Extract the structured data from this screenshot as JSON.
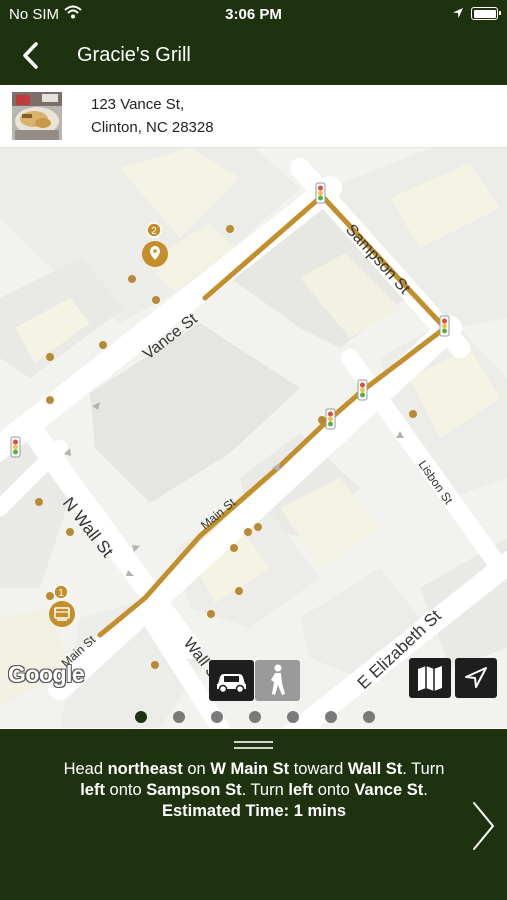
{
  "status_bar": {
    "carrier": "No SIM",
    "time": "3:06 PM"
  },
  "header": {
    "title": "Gracie's Grill"
  },
  "address": {
    "line1": "123 Vance St,",
    "line2": "Clinton, NC 28328"
  },
  "map": {
    "streets": {
      "vance": "Vance St",
      "sampson": "Sampson St",
      "n_wall": "N Wall St",
      "main_upper": "Main St",
      "main_lower": "Main St",
      "lisbon": "Lisbon St",
      "elizabeth": "E Elizabeth St",
      "wall_s": "Wall S"
    },
    "markers": {
      "destination": "2",
      "origin": "1"
    },
    "attribution": "Google",
    "route_color": "#c28f2c",
    "marker_color": "#b98a34"
  },
  "controls": {
    "car_icon": "car-icon",
    "walk_icon": "walking-person-icon",
    "layers_icon": "folded-map-icon",
    "locate_icon": "navigation-arrow-icon"
  },
  "pager": {
    "count": 7,
    "active_index": 0
  },
  "directions": {
    "parts": {
      "p1": "Head ",
      "b1": "northeast",
      "p2": " on ",
      "b2": "W Main St",
      "p3": " toward ",
      "b3": "Wall St",
      "p4": ". Turn ",
      "b4": "left",
      "p5": " onto ",
      "b5": "Sampson St",
      "p6": ". Turn ",
      "b6": "left",
      "p7": " onto ",
      "b7": "Vance St",
      "p8": "."
    },
    "estimate": "Estimated Time: 1 mins"
  },
  "theme": {
    "header_bg": "#1f3210",
    "accent": "#c28f2c"
  }
}
